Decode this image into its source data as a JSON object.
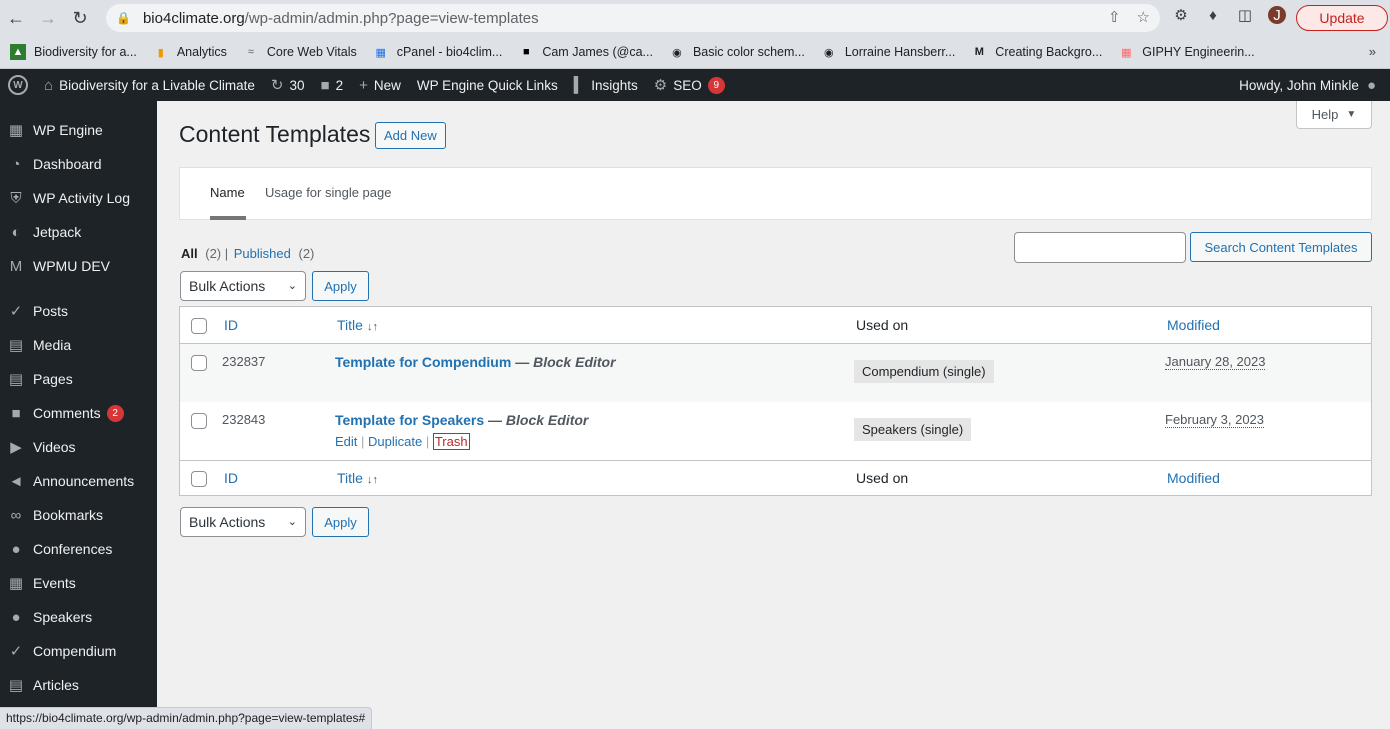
{
  "browser": {
    "url_host": "bio4climate.org",
    "url_path": "/wp-admin/admin.php?page=view-templates",
    "update_label": "Update",
    "profile_initial": "J",
    "bookmarks": [
      {
        "label": "Biodiversity for a...",
        "icon": "leaf-icon"
      },
      {
        "label": "Analytics",
        "icon": "analytics-icon"
      },
      {
        "label": "Core Web Vitals",
        "icon": "vitals-icon"
      },
      {
        "label": "cPanel - bio4clim...",
        "icon": "grid-icon"
      },
      {
        "label": "Cam James (@ca...",
        "icon": "unsplash-icon"
      },
      {
        "label": "Basic color schem...",
        "icon": "globe-icon"
      },
      {
        "label": "Lorraine Hansberr...",
        "icon": "globe-icon"
      },
      {
        "label": "Creating Backgro...",
        "icon": "m-icon"
      },
      {
        "label": "GIPHY Engineerin...",
        "icon": "giphy-icon"
      }
    ],
    "status_url": "https://bio4climate.org/wp-admin/admin.php?page=view-templates#"
  },
  "adminbar": {
    "site_name": "Biodiversity for a Livable Climate",
    "updates_count": "30",
    "comments_count": "2",
    "new_label": "New",
    "quick_links_label": "WP Engine Quick Links",
    "insights_label": "Insights",
    "seo_label": "SEO",
    "seo_badge": "9",
    "howdy": "Howdy, John Minkle"
  },
  "sidebar": {
    "items": [
      {
        "label": "WP Engine",
        "icon": "wpengine-icon"
      },
      {
        "label": "Dashboard",
        "icon": "dashboard-icon"
      },
      {
        "label": "WP Activity Log",
        "icon": "shield-icon"
      },
      {
        "label": "Jetpack",
        "icon": "jetpack-icon"
      },
      {
        "label": "WPMU DEV",
        "icon": "wpmudev-icon"
      },
      {
        "label": "Posts",
        "icon": "pin-icon"
      },
      {
        "label": "Media",
        "icon": "media-icon"
      },
      {
        "label": "Pages",
        "icon": "pages-icon"
      },
      {
        "label": "Comments",
        "icon": "comment-icon",
        "badge": "2"
      },
      {
        "label": "Videos",
        "icon": "video-icon"
      },
      {
        "label": "Announcements",
        "icon": "megaphone-icon"
      },
      {
        "label": "Bookmarks",
        "icon": "link-icon"
      },
      {
        "label": "Conferences",
        "icon": "groups-icon"
      },
      {
        "label": "Events",
        "icon": "calendar-icon"
      },
      {
        "label": "Speakers",
        "icon": "person-icon"
      },
      {
        "label": "Compendium",
        "icon": "pin-icon"
      },
      {
        "label": "Articles",
        "icon": "pages-icon"
      }
    ]
  },
  "page": {
    "help_label": "Help",
    "title": "Content Templates",
    "add_new_label": "Add New",
    "tabs": [
      "Name",
      "Usage for single page"
    ],
    "filter_all": "All",
    "filter_all_count": "(2)",
    "filter_published": "Published",
    "filter_published_count": "(2)",
    "search_button": "Search Content Templates",
    "search_value": "",
    "bulk_actions": "Bulk Actions",
    "apply_label": "Apply"
  },
  "table": {
    "columns": {
      "id": "ID",
      "title": "Title",
      "used_on": "Used on",
      "modified": "Modified"
    },
    "rows": [
      {
        "id": "232837",
        "title": "Template for Compendium",
        "editor": "Block Editor",
        "used_on": "Compendium (single)",
        "modified": "January 28, 2023"
      },
      {
        "id": "232843",
        "title": "Template for Speakers",
        "editor": "Block Editor",
        "used_on": "Speakers (single)",
        "modified": "February 3, 2023",
        "actions": {
          "edit": "Edit",
          "duplicate": "Duplicate",
          "trash": "Trash"
        }
      }
    ]
  }
}
